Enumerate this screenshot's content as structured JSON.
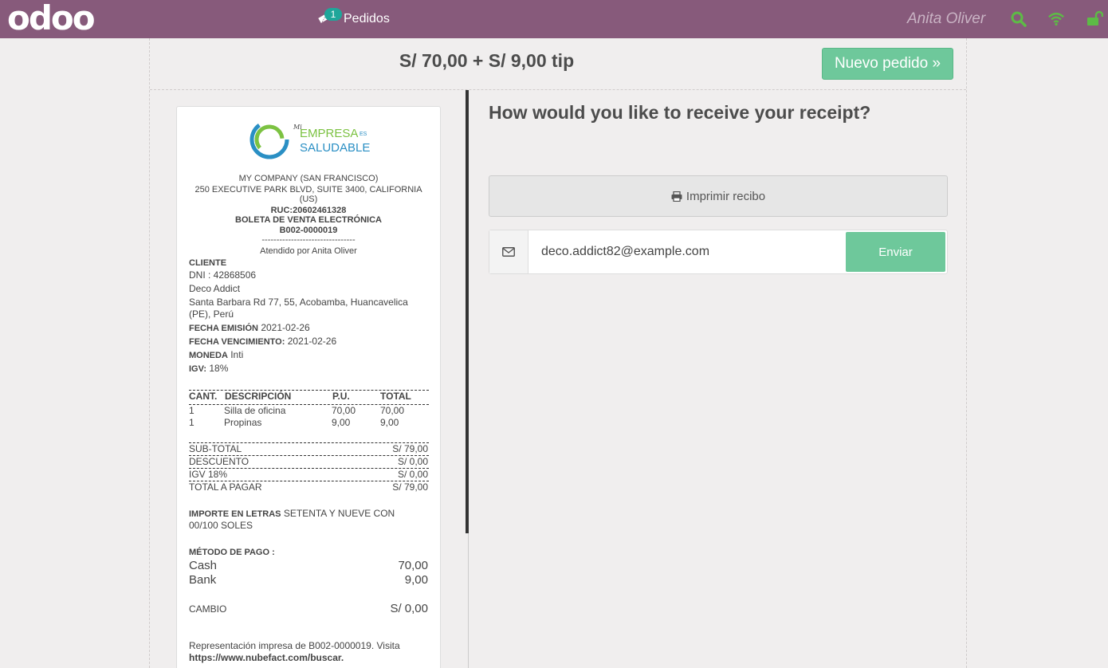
{
  "topbar": {
    "logo_text": "odoo",
    "orders_label": "Pedidos",
    "orders_count": "1",
    "username": "Anita Oliver",
    "icons": [
      "search-icon",
      "wifi-icon",
      "unlock-icon"
    ]
  },
  "header": {
    "total": "S/ 70,00 + S/ 9,00 tip",
    "new_order": "Nuevo pedido »"
  },
  "receipt": {
    "logo": {
      "small": "Mi",
      "line1": "EMPRESA",
      "es": "ES",
      "line2": "SALUDABLE"
    },
    "company": "MY COMPANY (SAN FRANCISCO)",
    "address1": "250 EXECUTIVE PARK BLVD, SUITE 3400, CALIFORNIA",
    "address2": "(US)",
    "ruc": "RUC:20602461328",
    "doc_type": "BOLETA DE VENTA ELECTRÓNICA",
    "doc_number": "B002-0000019",
    "separator": "--------------------------------",
    "served_by": "Atendido por Anita Oliver",
    "client_label": "CLIENTE",
    "dni": "DNI : 42868506",
    "client_name": "Deco Addict",
    "client_address1": "Santa Barbara Rd 77, 55, Acobamba, Huancavelica",
    "client_address2": "(PE), Perú",
    "issue_label": "FECHA EMISIÓN",
    "issue_date": " 2021-02-26",
    "due_label": "FECHA VENCIMIENTO:",
    "due_date": " 2021-02-26",
    "currency_label": "MONEDA",
    "currency": " Inti",
    "igv_label": "IGV:",
    "igv": " 18%",
    "table_headers": {
      "qty": "CANT.",
      "desc": "DESCRIPCIÓN",
      "pu": "P.U.",
      "total": "TOTAL"
    },
    "lines": [
      {
        "qty": "1",
        "desc": "Silla de oficina",
        "pu": "70,00",
        "total": "70,00"
      },
      {
        "qty": "1",
        "desc": "Propinas",
        "pu": "9,00",
        "total": "9,00"
      }
    ],
    "summary": [
      {
        "label": "SUB-TOTAL",
        "value": "S/ 79,00"
      },
      {
        "label": "DESCUENTO",
        "value": "S/ 0,00"
      },
      {
        "label": "IGV 18%",
        "value": "S/ 0,00"
      },
      {
        "label": "TOTAL A PAGAR",
        "value": "S/ 79,00"
      }
    ],
    "amount_words_label": "IMPORTE EN LETRAS",
    "amount_words1": " SETENTA Y NUEVE CON",
    "amount_words2": "00/100 SOLES",
    "payment_label": "MÉTODO DE PAGO :",
    "payments": [
      {
        "method": "Cash",
        "amount": "70,00"
      },
      {
        "method": "Bank",
        "amount": "9,00"
      }
    ],
    "change_label": "CAMBIO",
    "change_value": "S/ 0,00",
    "footer1": "Representación impresa de B002-0000019. Visita",
    "footer2": "https://www.nubefact.com/buscar."
  },
  "panel": {
    "question": "How would you like to receive your receipt?",
    "print_label": "Imprimir recibo",
    "email_value": "deco.addict82@example.com",
    "send_label": "Enviar"
  },
  "colors": {
    "topbar": "#875a7b",
    "accent_green": "#6ec89b",
    "badge": "#1fa69a",
    "status_icons": "#5dbb46"
  }
}
